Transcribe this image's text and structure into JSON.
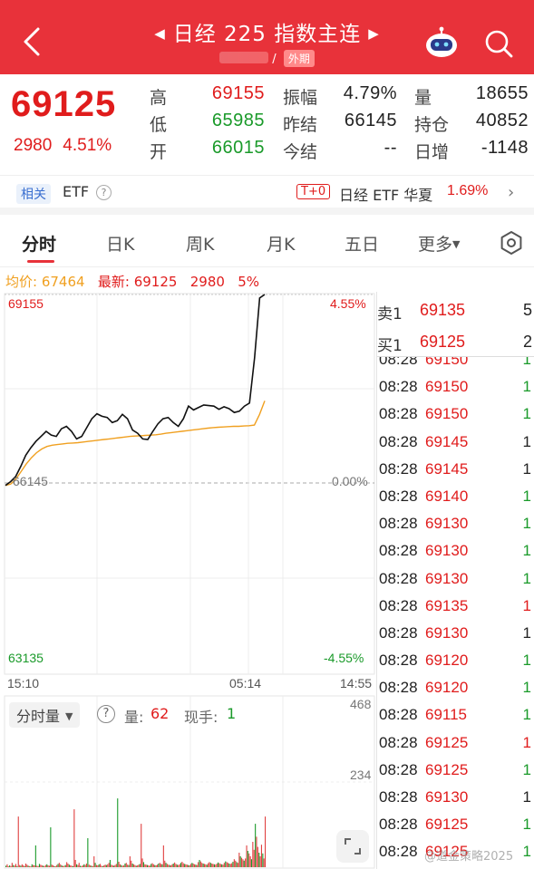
{
  "header": {
    "title": "日经 225 指数主连",
    "badge": "外期",
    "prev_arrow": "◀",
    "next_arrow": "▶",
    "colors": {
      "bg": "#e8323a"
    }
  },
  "quote": {
    "last": "69125",
    "change": "2980",
    "change_pct": "4.51%",
    "stats": {
      "high_label": "高",
      "high": "69155",
      "low_label": "低",
      "low": "65985",
      "open_label": "开",
      "open": "66015",
      "amp_label": "振幅",
      "amp": "4.79%",
      "prev_settle_label": "昨结",
      "prev_settle": "66145",
      "today_settle_label": "今结",
      "today_settle": "--",
      "volume_label": "量",
      "volume": "18655",
      "oi_label": "持仓",
      "oi": "40852",
      "daily_inc_label": "日增",
      "daily_inc": "-1148"
    }
  },
  "etf": {
    "related_tag": "相关",
    "etf_label": "ETF",
    "t0_tag": "T+0",
    "name": "日经 ETF 华夏",
    "pct": "1.69%"
  },
  "tabs": [
    {
      "label": "分时"
    },
    {
      "label": "日K"
    },
    {
      "label": "周K"
    },
    {
      "label": "月K"
    },
    {
      "label": "五日"
    },
    {
      "label": "更多"
    }
  ],
  "info_line": {
    "avg_label": "均价:",
    "avg": "67464",
    "latest_label": "最新:",
    "latest": "69125",
    "change": "2980",
    "pct": "5%"
  },
  "chart_data": {
    "type": "line",
    "y_axis": {
      "top": "69155",
      "mid": "66145",
      "bottom": "63135",
      "top_pct": "4.55%",
      "mid_pct": "0.00%",
      "bottom_pct": "-4.55%",
      "ylim": [
        63135,
        69155
      ]
    },
    "x_axis": {
      "labels": [
        "15:10",
        "05:14",
        "14:55"
      ]
    },
    "series": [
      {
        "name": "最新",
        "color": "#111111",
        "values": [
          66120,
          66180,
          66260,
          66420,
          66600,
          66720,
          66820,
          66900,
          66980,
          66920,
          66900,
          67020,
          67060,
          66980,
          66860,
          66900,
          67040,
          67180,
          67260,
          67220,
          67200,
          67120,
          67150,
          67250,
          67180,
          67000,
          66950,
          66860,
          66850,
          66980,
          67100,
          67180,
          67200,
          67120,
          67060,
          67180,
          67380,
          67320,
          67360,
          67400,
          67390,
          67380,
          67330,
          67370,
          67340,
          67280,
          67300,
          67380,
          67430,
          68150,
          69100,
          69155
        ]
      },
      {
        "name": "均价",
        "color": "#f0a020",
        "values": [
          66120,
          66140,
          66220,
          66340,
          66460,
          66560,
          66640,
          66700,
          66740,
          66760,
          66770,
          66780,
          66790,
          66795,
          66800,
          66810,
          66820,
          66830,
          66840,
          66850,
          66860,
          66870,
          66880,
          66890,
          66900,
          66905,
          66910,
          66915,
          66920,
          66925,
          66935,
          66950,
          66960,
          66970,
          66980,
          66990,
          67000,
          67010,
          67020,
          67030,
          67040,
          67045,
          67050,
          67055,
          67060,
          67060,
          67065,
          67070,
          67080,
          67250,
          67464
        ]
      }
    ],
    "volume": {
      "ticks": [
        "468",
        "234"
      ],
      "ymax": 468,
      "bars": [
        4,
        8,
        2,
        5,
        3,
        12,
        6,
        4,
        9,
        3,
        140,
        6,
        4,
        8,
        5,
        3,
        10,
        7,
        4,
        3,
        2,
        8,
        6,
        5,
        60,
        4,
        3,
        9,
        7,
        5,
        4,
        3,
        6,
        8,
        5,
        4,
        110,
        7,
        5,
        3,
        2,
        6,
        9,
        12,
        8,
        5,
        3,
        4,
        6,
        14,
        10,
        7,
        5,
        4,
        3,
        160,
        20,
        8,
        6,
        12,
        4,
        3,
        5,
        8,
        6,
        10,
        80,
        7,
        5,
        4,
        3,
        30,
        12,
        6,
        5,
        8,
        9,
        4,
        3,
        5,
        7,
        6,
        8,
        12,
        20,
        7,
        5,
        4,
        6,
        9,
        190,
        15,
        8,
        6,
        4,
        5,
        10,
        12,
        7,
        6,
        30,
        18,
        10,
        8,
        6,
        4,
        5,
        7,
        9,
        120,
        24,
        14,
        8,
        7,
        6,
        5,
        4,
        9,
        11,
        8,
        6,
        5,
        7,
        10,
        12,
        9,
        8,
        60,
        18,
        12,
        9,
        7,
        6,
        5,
        8,
        10,
        13,
        9,
        7,
        6,
        8,
        12,
        15,
        11,
        9,
        8,
        7,
        6,
        5,
        9,
        12,
        10,
        8,
        7,
        6,
        14,
        20,
        16,
        12,
        10,
        9,
        8,
        7,
        11,
        14,
        12,
        10,
        9,
        8,
        7,
        10,
        13,
        11,
        9,
        8,
        7,
        12,
        16,
        14,
        12,
        10,
        9,
        11,
        15,
        22,
        18,
        14,
        12,
        40,
        30,
        26,
        22,
        18,
        24,
        60,
        45,
        38,
        30,
        22,
        70,
        48,
        120,
        84,
        56,
        40,
        30,
        62,
        38,
        24,
        140
      ]
    }
  },
  "volume_header": {
    "select_label": "分时量",
    "vol_label": "量:",
    "vol": "62",
    "hand_label": "现手:",
    "hand": "1"
  },
  "orderbook": [
    {
      "side": "卖1",
      "price": "69135",
      "qty": "5"
    },
    {
      "side": "买1",
      "price": "69125",
      "qty": "2"
    }
  ],
  "trades": [
    {
      "time": "08:28",
      "price": "69150",
      "vol": "1",
      "dir": "up"
    },
    {
      "time": "08:28",
      "price": "69150",
      "vol": "1",
      "dir": "up"
    },
    {
      "time": "08:28",
      "price": "69150",
      "vol": "1",
      "dir": "up"
    },
    {
      "time": "08:28",
      "price": "69145",
      "vol": "1",
      "dir": "none"
    },
    {
      "time": "08:28",
      "price": "69145",
      "vol": "1",
      "dir": "none"
    },
    {
      "time": "08:28",
      "price": "69140",
      "vol": "1",
      "dir": "up"
    },
    {
      "time": "08:28",
      "price": "69130",
      "vol": "1",
      "dir": "up"
    },
    {
      "time": "08:28",
      "price": "69130",
      "vol": "1",
      "dir": "up"
    },
    {
      "time": "08:28",
      "price": "69130",
      "vol": "1",
      "dir": "up"
    },
    {
      "time": "08:28",
      "price": "69135",
      "vol": "1",
      "dir": "down"
    },
    {
      "time": "08:28",
      "price": "69130",
      "vol": "1",
      "dir": "none"
    },
    {
      "time": "08:28",
      "price": "69120",
      "vol": "1",
      "dir": "up"
    },
    {
      "time": "08:28",
      "price": "69120",
      "vol": "1",
      "dir": "up"
    },
    {
      "time": "08:28",
      "price": "69115",
      "vol": "1",
      "dir": "up"
    },
    {
      "time": "08:28",
      "price": "69125",
      "vol": "1",
      "dir": "down"
    },
    {
      "time": "08:28",
      "price": "69125",
      "vol": "1",
      "dir": "up"
    },
    {
      "time": "08:28",
      "price": "69130",
      "vol": "1",
      "dir": "none"
    },
    {
      "time": "08:28",
      "price": "69125",
      "vol": "1",
      "dir": "up"
    },
    {
      "time": "08:28",
      "price": "69125",
      "vol": "1",
      "dir": "up"
    }
  ],
  "watermark": "@道金策略2025"
}
